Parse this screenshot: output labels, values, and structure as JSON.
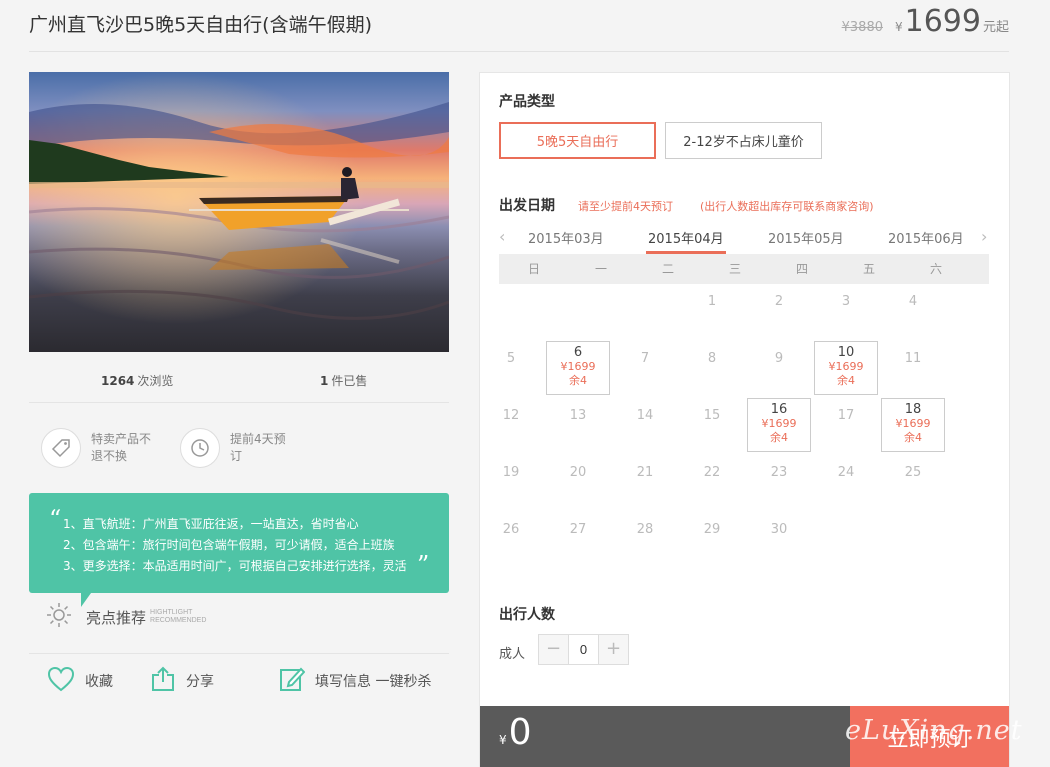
{
  "header": {
    "title": "广州直飞沙巴5晚5天自由行(含端午假期)",
    "old_price": "¥3880",
    "currency": "¥",
    "price": "1699",
    "price_suffix": "元起"
  },
  "stats": {
    "views_count": "1264",
    "views_label": "次浏览",
    "sold_count": "1",
    "sold_label": "件已售"
  },
  "features": [
    {
      "icon": "tag-icon",
      "label": "特卖产品不退不换"
    },
    {
      "icon": "clock-icon",
      "label": "提前4天预订"
    }
  ],
  "highlights": {
    "lines": [
      "1、直飞航班：广州直飞亚庇往返，一站直达，省时省心",
      "2、包含端午：旅行时间包含端午假期，可少请假，适合上班族",
      "3、更多选择：本品适用时间广，可根据自己安排进行选择，灵活"
    ],
    "title": "亮点推荐",
    "title_en_1": "HIGHTLIGHT",
    "title_en_2": "RECOMMENDED"
  },
  "actions": {
    "favorite": "收藏",
    "share": "分享",
    "fill_info": "填写信息 一键秒杀"
  },
  "booking": {
    "product_type_label": "产品类型",
    "product_types": [
      "5晚5天自由行",
      "2-12岁不占床儿童价"
    ],
    "selected_type_index": 0,
    "date_label": "出发日期",
    "hint_1": "请至少提前4天预订",
    "hint_2": "(出行人数超出库存可联系商家咨询)",
    "months": [
      "2015年03月",
      "2015年04月",
      "2015年05月",
      "2015年06月"
    ],
    "active_month_index": 1,
    "weekdays": [
      "日",
      "一",
      "二",
      "三",
      "四",
      "五",
      "六"
    ],
    "first_weekday": 3,
    "days_in_month": 30,
    "available": {
      "6": {
        "price": "¥1699",
        "stock": "余4"
      },
      "10": {
        "price": "¥1699",
        "stock": "余4"
      },
      "16": {
        "price": "¥1699",
        "stock": "余4"
      },
      "18": {
        "price": "¥1699",
        "stock": "余4"
      }
    },
    "travelers_label": "出行人数",
    "adult_label": "成人",
    "adult_count": "0",
    "minus": "−",
    "plus": "+",
    "total_currency": "¥",
    "total": "0",
    "book_button": "立即预订"
  },
  "watermark": "eLuXing.net",
  "colors": {
    "accent": "#ea6e58",
    "highlight_bg": "#4fc4a6",
    "bar_bg": "#5a5a5a",
    "book_bg": "#f2705f"
  }
}
